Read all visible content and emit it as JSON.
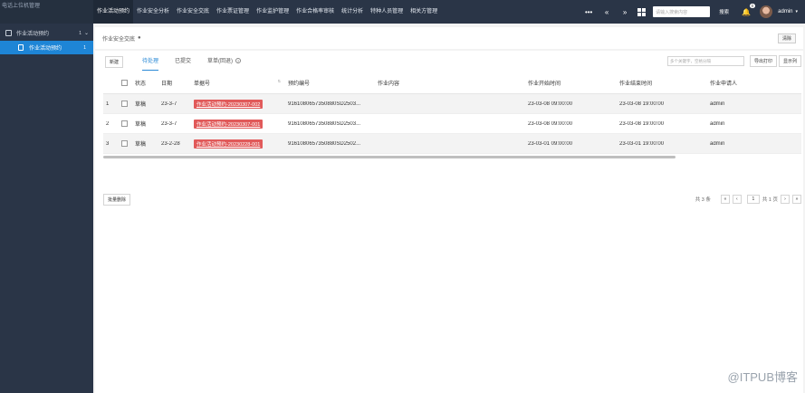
{
  "sidebar": {
    "logo": "电话上位机管理",
    "group": {
      "label": "作业活动预约",
      "count": "1"
    },
    "active_item": {
      "label": "作业活动预约",
      "count": "1"
    }
  },
  "topnav": {
    "items": [
      "作业活动预约",
      "作业安全分析",
      "作业安全交底",
      "作业票证管理",
      "作业监护管理",
      "作业合格率审核",
      "统计分析",
      "特种人员管理",
      "相关方管理"
    ],
    "more": "•••",
    "prev": "«",
    "next": "»",
    "search_placeholder": "请输入搜索内容",
    "search_btn": "搜索",
    "bell_badge": "0",
    "user": "admin",
    "user_chevron": "▾"
  },
  "breadcrumb": {
    "title": "作业安全交底",
    "tool": "清除"
  },
  "toolbar": {
    "new_btn": "新建",
    "tabs": [
      "待处理",
      "已提交",
      "草单(回退)"
    ],
    "search_placeholder": "多个关键字，空格分隔",
    "export_btn": "导出打印",
    "col_btn": "显示列"
  },
  "table": {
    "headers": {
      "status": "状态",
      "date": "日期",
      "doc": "单据号",
      "code": "预约编号",
      "content": "作业内容",
      "start": "作业开始时间",
      "end": "作业结束时间",
      "applicant": "作业申请人"
    },
    "sort_icon": "⇅",
    "rows": [
      {
        "no": "1",
        "status": "草稿",
        "date": "23-3-7",
        "doc": "作业活动预约-20230307-002",
        "code": "9161080657350880SD2503...",
        "content": "",
        "start": "23-03-08 09:00:00",
        "end": "23-03-08 19:00:00",
        "applicant": "admin"
      },
      {
        "no": "2",
        "status": "草稿",
        "date": "23-3-7",
        "doc": "作业活动预约-20230307-001",
        "code": "9161080657350880SD2503...",
        "content": "",
        "start": "23-03-08 09:00:00",
        "end": "23-03-08 19:00:00",
        "applicant": "admin"
      },
      {
        "no": "3",
        "status": "草稿",
        "date": "23-2-28",
        "doc": "作业活动预约-20230228-001",
        "code": "9161080657350880SD2502...",
        "content": "",
        "start": "23-03-01 09:00:00",
        "end": "23-03-01 19:00:00",
        "applicant": "admin"
      }
    ]
  },
  "footer": {
    "batch_delete": "批量删除",
    "total": "共 3 条",
    "page": "1",
    "pages_text": "共 1 页",
    "first": "«",
    "prev": "‹",
    "next": "›",
    "last": "»"
  },
  "watermark": "@ITPUB博客"
}
